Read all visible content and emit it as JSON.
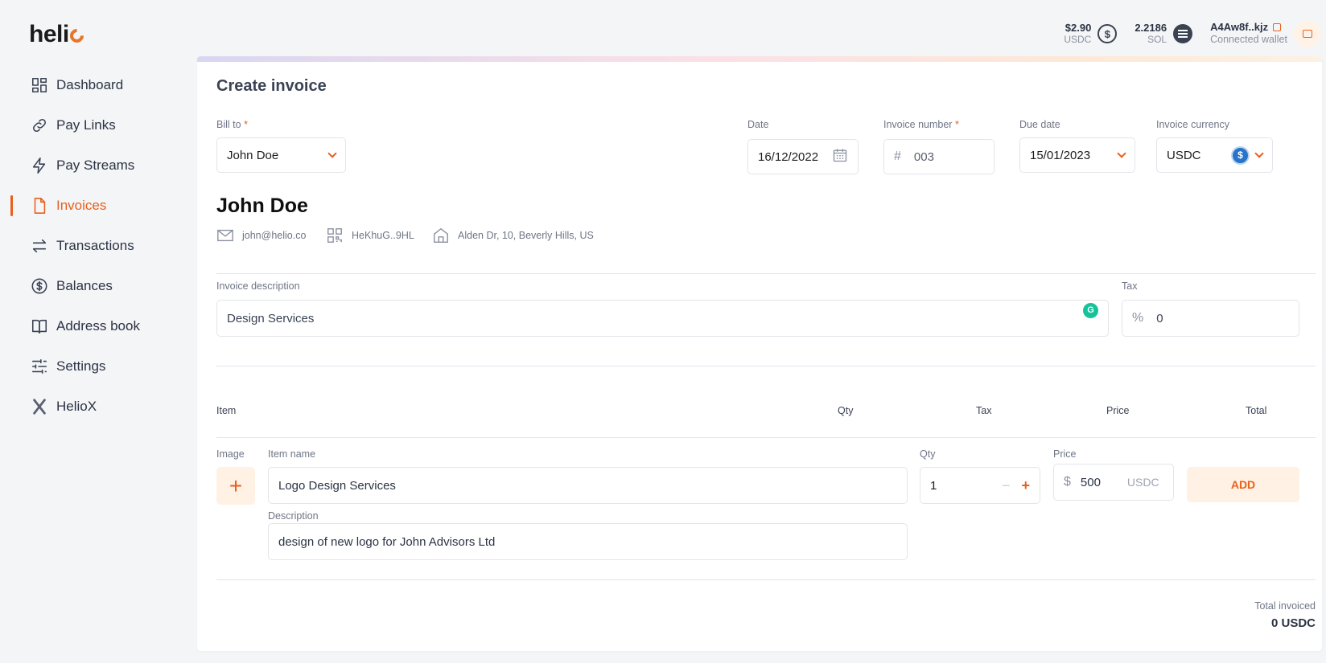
{
  "brand": {
    "name_prefix": "heli",
    "accent": "#e8601c"
  },
  "sidebar": {
    "items": [
      {
        "label": "Dashboard",
        "icon": "dashboard-icon"
      },
      {
        "label": "Pay Links",
        "icon": "link-icon"
      },
      {
        "label": "Pay Streams",
        "icon": "lightning-icon"
      },
      {
        "label": "Invoices",
        "icon": "document-icon",
        "active": true
      },
      {
        "label": "Transactions",
        "icon": "arrows-swap-icon"
      },
      {
        "label": "Balances",
        "icon": "dollar-circle-icon"
      },
      {
        "label": "Address book",
        "icon": "book-icon"
      },
      {
        "label": "Settings",
        "icon": "sliders-icon"
      },
      {
        "label": "HelioX",
        "icon": "heliox-icon"
      }
    ]
  },
  "topbar": {
    "usdc_amount": "$2.90",
    "usdc_label": "USDC",
    "usdc_coin_glyph": "$",
    "sol_amount": "2.2186",
    "sol_label": "SOL",
    "wallet_address": "A4Aw8f..kjz",
    "wallet_status": "Connected wallet"
  },
  "invoice": {
    "title": "Create invoice",
    "bill_to_label": "Bill to",
    "required_mark": "*",
    "bill_to_value": "John Doe",
    "date_label": "Date",
    "date_value": "16/12/2022",
    "invoice_number_label": "Invoice number",
    "invoice_number_prefix": "#",
    "invoice_number_value": "003",
    "due_date_label": "Due date",
    "due_date_value": "15/01/2023",
    "currency_label": "Invoice currency",
    "currency_value": "USDC",
    "currency_coin_glyph": "$",
    "client_name": "John Doe",
    "client_email": "john@helio.co",
    "client_wallet": "HeKhuG..9HL",
    "client_address": "Alden Dr, 10, Beverly Hills, US",
    "description_label": "Invoice description",
    "description_value": "Design Services",
    "grammarly_glyph": "G",
    "tax_label": "Tax",
    "tax_prefix": "%",
    "tax_value": "0"
  },
  "items_table": {
    "columns": [
      "Item",
      "Qty",
      "Tax",
      "Price",
      "Total"
    ]
  },
  "new_item": {
    "image_label": "Image",
    "add_image_glyph": "+",
    "item_name_label": "Item name",
    "item_name_value": "Logo Design Services",
    "description_label": "Description",
    "description_value": "design of new logo for John Advisors Ltd",
    "qty_label": "Qty",
    "qty_value": "1",
    "qty_minus_glyph": "−",
    "qty_plus_glyph": "+",
    "price_label": "Price",
    "price_prefix": "$",
    "price_value": "500",
    "price_currency": "USDC",
    "add_button": "ADD"
  },
  "summary": {
    "total_label": "Total invoiced",
    "total_value": "0 USDC"
  }
}
